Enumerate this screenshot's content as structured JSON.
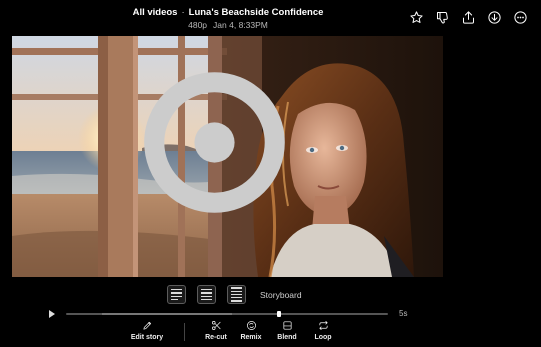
{
  "header": {
    "breadcrumb": "All videos",
    "separator": "·",
    "title": "Luna's Beachside Confidence",
    "resolution": "480p",
    "timestamp": "Jan 4, 8:33PM"
  },
  "top_actions": [
    {
      "name": "favorite",
      "icon": "star-icon"
    },
    {
      "name": "dislike",
      "icon": "thumbs-down-icon"
    },
    {
      "name": "share",
      "icon": "share-icon"
    },
    {
      "name": "download",
      "icon": "download-icon"
    },
    {
      "name": "more",
      "icon": "more-icon"
    }
  ],
  "storyboard": {
    "label": "Storyboard"
  },
  "player": {
    "duration": "5s",
    "progress": 0.0
  },
  "actions": {
    "edit_story": "Edit story",
    "recut": "Re-cut",
    "remix": "Remix",
    "blend": "Blend",
    "loop": "Loop"
  },
  "colors": {
    "background": "#000000",
    "accent": "#ffffff",
    "muted_text": "#b8b8b8"
  }
}
